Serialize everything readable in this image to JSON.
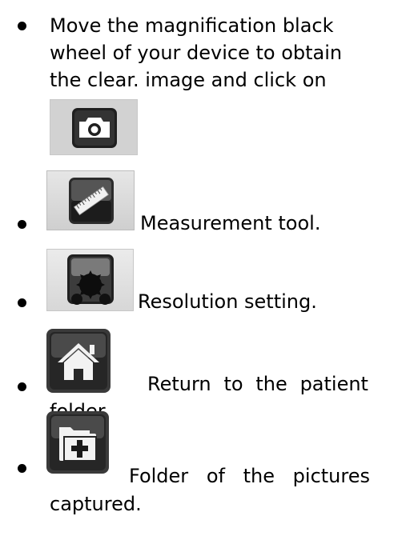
{
  "items": [
    {
      "lines": [
        "Move the magnification black",
        "wheel of your device  to obtain",
        "the clear.  image  and click on"
      ]
    },
    {
      "label": "Measurement tool."
    },
    {
      "label": "Resolution setting."
    },
    {
      "words1": [
        "Return",
        "to",
        "the",
        "patient"
      ],
      "line2": "folder."
    },
    {
      "words1": [
        "Folder",
        "of",
        "the",
        "pictures"
      ],
      "line2": "captured."
    }
  ],
  "icons": [
    "camera-icon",
    "ruler-icon",
    "gear-icon",
    "home-icon",
    "folder-add-icon"
  ],
  "colors": {
    "icon_dark": "#2a2a2a",
    "icon_light": "#d2d2d2"
  }
}
